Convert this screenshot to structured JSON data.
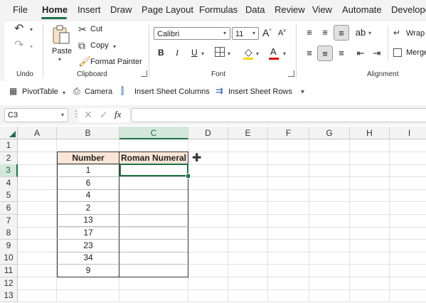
{
  "menu": {
    "items": [
      "File",
      "Home",
      "Insert",
      "Draw",
      "Page Layout",
      "Formulas",
      "Data",
      "Review",
      "View",
      "Automate",
      "Develope"
    ],
    "active_index": 1
  },
  "ribbon": {
    "undo_group_label": "Undo",
    "clipboard": {
      "label": "Clipboard",
      "paste": "Paste",
      "cut": "Cut",
      "copy": "Copy",
      "format_painter": "Format Painter"
    },
    "font": {
      "label": "Font",
      "font_name": "Calibri",
      "font_size": "11",
      "bold": "B",
      "italic": "I",
      "underline": "U",
      "grow": "A",
      "shrink": "A"
    },
    "alignment": {
      "label": "Alignment",
      "wrap": "Wrap",
      "merge": "Merge"
    }
  },
  "qat": {
    "pivot_table": "PivotTable",
    "camera": "Camera",
    "insert_sheet_columns": "Insert Sheet Columns",
    "insert_sheet_rows": "Insert Sheet Rows"
  },
  "formula_bar": {
    "name_box": "C3",
    "fx": "fx",
    "formula": ""
  },
  "grid": {
    "columns": [
      "A",
      "B",
      "C",
      "D",
      "E",
      "F",
      "G",
      "H",
      "I"
    ],
    "selected_column": "C",
    "rows": [
      "1",
      "2",
      "3",
      "4",
      "5",
      "6",
      "7",
      "8",
      "9",
      "10",
      "11",
      "12",
      "13"
    ],
    "selected_row": "3",
    "table": {
      "headers": [
        "Number",
        "Roman Numeral"
      ],
      "numbers": [
        "1",
        "6",
        "4",
        "2",
        "13",
        "17",
        "23",
        "34",
        "9"
      ]
    }
  },
  "colors": {
    "accent": "#1e7145",
    "header_fill": "#fbe5d6",
    "selection_header": "#d3e8da"
  }
}
